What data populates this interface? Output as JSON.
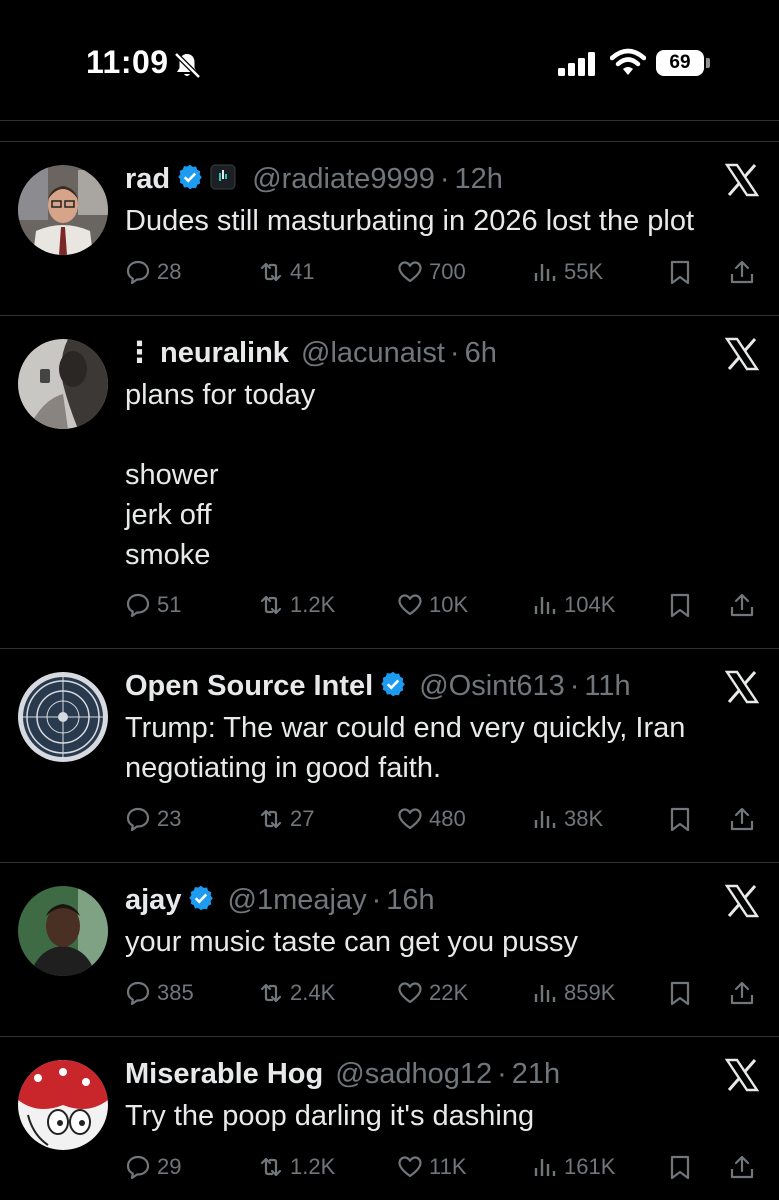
{
  "status_bar": {
    "time": "11:09",
    "battery": "69"
  },
  "tweets": [
    {
      "name": "rad",
      "handle": "@radiate9999",
      "dot": "·",
      "ago": "12h",
      "verified": true,
      "body": "Dudes still masturbating in 2026 lost the plot",
      "replies": "28",
      "reposts": "41",
      "likes": "700",
      "views": "55K"
    },
    {
      "name": "neuralink",
      "handle": "@lacunaist",
      "dot": "·",
      "ago": "6h",
      "verified": false,
      "body": "plans for today\n\nshower\njerk off\nsmoke",
      "replies": "51",
      "reposts": "1.2K",
      "likes": "10K",
      "views": "104K"
    },
    {
      "name": "Open Source Intel",
      "handle": "@Osint613",
      "dot": "·",
      "ago": "11h",
      "verified": true,
      "body": "Trump: The war could end very quickly, Iran\nnegotiating in good faith.",
      "replies": "23",
      "reposts": "27",
      "likes": "480",
      "views": "38K"
    },
    {
      "name": "ajay",
      "handle": "@1meajay",
      "dot": "·",
      "ago": "16h",
      "verified": true,
      "body": "your music taste can get you pussy",
      "replies": "385",
      "reposts": "2.4K",
      "likes": "22K",
      "views": "859K"
    },
    {
      "name": "Miserable Hog",
      "handle": "@sadhog12",
      "dot": "·",
      "ago": "21h",
      "verified": false,
      "body": "Try the poop darling it's dashing",
      "replies": "29",
      "reposts": "1.2K",
      "likes": "11K",
      "views": "161K"
    }
  ],
  "colors": {
    "background": "#000000",
    "text": "#e7e9ea",
    "muted": "#71767b",
    "verified": "#1d9bf0",
    "divider": "#2f3336"
  },
  "icons": [
    "bell-slash-icon",
    "cellular-signal-icon",
    "wifi-icon",
    "battery-icon",
    "x-logo-icon",
    "verified-badge-icon",
    "reply-icon",
    "repost-icon",
    "like-icon",
    "views-icon",
    "bookmark-icon",
    "share-icon"
  ]
}
